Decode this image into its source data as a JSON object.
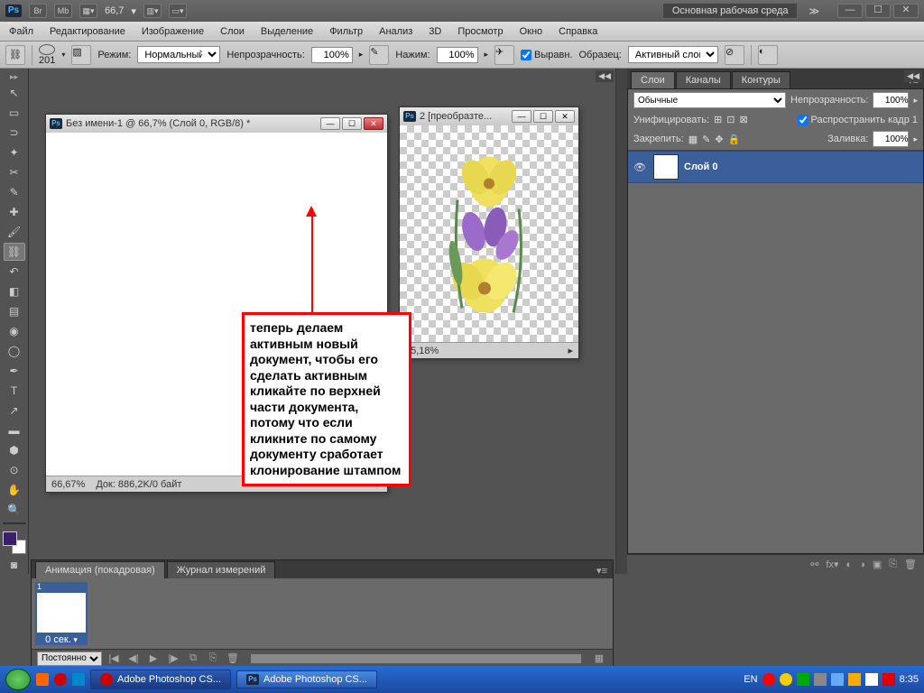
{
  "topbar": {
    "zoom": "66,7",
    "workspace": "Основная рабочая среда"
  },
  "menu": [
    "Файл",
    "Редактирование",
    "Изображение",
    "Слои",
    "Выделение",
    "Фильтр",
    "Анализ",
    "3D",
    "Просмотр",
    "Окно",
    "Справка"
  ],
  "options": {
    "brush_size": "201",
    "mode_label": "Режим:",
    "mode_value": "Нормальный",
    "opacity_label": "Непрозрачность:",
    "opacity_value": "100%",
    "flow_label": "Нажим:",
    "flow_value": "100%",
    "align_label": "Выравн.",
    "sample_label": "Образец:",
    "sample_value": "Активный слой"
  },
  "doc1": {
    "title": "Без имени-1 @ 66,7% (Слой 0, RGB/8) *",
    "zoom": "66,67%",
    "docinfo": "Док: 886,2K/0 байт"
  },
  "doc2": {
    "title": "2 [преобразте...",
    "zoom": "55,18%"
  },
  "annotation": "теперь делаем активным новый документ, чтобы его сделать активным кликайте по верхней части документа, потому что если кликните по самому документу сработает клонирование штампом",
  "layers_panel": {
    "tabs": [
      "Слои",
      "Каналы",
      "Контуры"
    ],
    "blend": "Обычные",
    "opacity_label": "Непрозрачность:",
    "opacity_value": "100%",
    "unify_label": "Унифицировать:",
    "propagate_label": "Распространить кадр 1",
    "lock_label": "Закрепить:",
    "fill_label": "Заливка:",
    "fill_value": "100%",
    "layer_name": "Слой 0"
  },
  "animation": {
    "tabs": [
      "Анимация (покадровая)",
      "Журнал измерений"
    ],
    "frame_num": "1",
    "frame_time": "0 сек.",
    "loop": "Постоянно"
  },
  "taskbar": {
    "app1": "Adobe Photoshop CS...",
    "app2": "Adobe Photoshop CS...",
    "lang": "EN",
    "time": "8:35"
  }
}
